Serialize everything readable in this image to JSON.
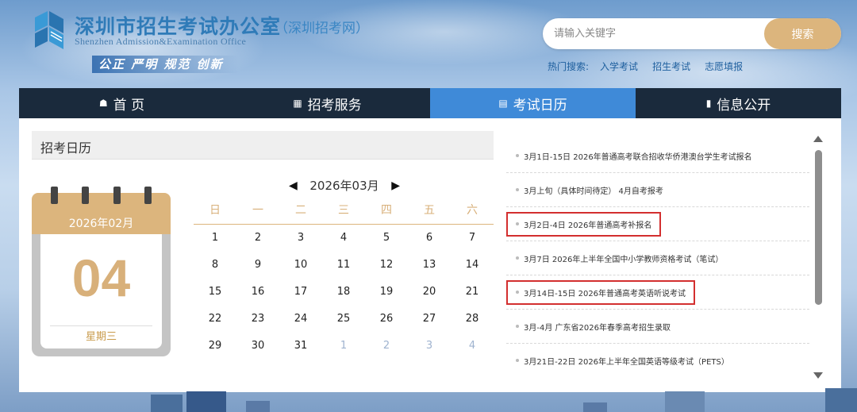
{
  "header": {
    "title": "深圳市招生考试办公室",
    "title_sub": "（深圳招考网）",
    "title_en": "Shenzhen Admission&Examination Office",
    "motto": "公正 严明 规范 创新"
  },
  "search": {
    "placeholder": "请输入关键字",
    "button": "搜索",
    "hot_label": "热门搜索:",
    "hot_items": [
      "入学考试",
      "招生考试",
      "志愿填报"
    ]
  },
  "nav": [
    {
      "label": "首 页",
      "icon": "home-icon"
    },
    {
      "label": "招考服务",
      "icon": "grid-icon"
    },
    {
      "label": "考试日历",
      "icon": "calendar-icon",
      "active": true
    },
    {
      "label": "信息公开",
      "icon": "document-icon"
    }
  ],
  "panel": {
    "heading": "招考日历"
  },
  "desk_calendar": {
    "month": "2026年02月",
    "day": "04",
    "weekday": "星期三"
  },
  "month_calendar": {
    "month_label": "2026年03月",
    "weekdays": [
      "日",
      "一",
      "二",
      "三",
      "四",
      "五",
      "六"
    ],
    "rows": [
      [
        "1",
        "2",
        "3",
        "4",
        "5",
        "6",
        "7"
      ],
      [
        "8",
        "9",
        "10",
        "11",
        "12",
        "13",
        "14"
      ],
      [
        "15",
        "16",
        "17",
        "18",
        "19",
        "20",
        "21"
      ],
      [
        "22",
        "23",
        "24",
        "25",
        "26",
        "27",
        "28"
      ],
      [
        "29",
        "30",
        "31",
        "1",
        "2",
        "3",
        "4"
      ]
    ],
    "next_month_days_in_last_row": 4
  },
  "events": [
    {
      "text": "3月1日-15日 2026年普通高考联合招收华侨港澳台学生考试报名",
      "highlighted": false
    },
    {
      "text": "3月上旬（具体时间待定） 4月自考报考",
      "highlighted": false
    },
    {
      "text": "3月2日-4日 2026年普通高考补报名",
      "highlighted": true
    },
    {
      "text": "3月7日 2026年上半年全国中小学教师资格考试（笔试）",
      "highlighted": false
    },
    {
      "text": "3月14日-15日 2026年普通高考英语听说考试",
      "highlighted": true
    },
    {
      "text": "3月-4月 广东省2026年春季高考招生录取",
      "highlighted": false
    },
    {
      "text": "3月21日-22日 2026年上半年全国英语等级考试（PETS）",
      "highlighted": false
    }
  ],
  "colors": {
    "nav_bg": "#1a2a3c",
    "nav_active": "#3f8ad8",
    "gold": "#dcb57d",
    "highlight_box": "#d32f2f"
  }
}
